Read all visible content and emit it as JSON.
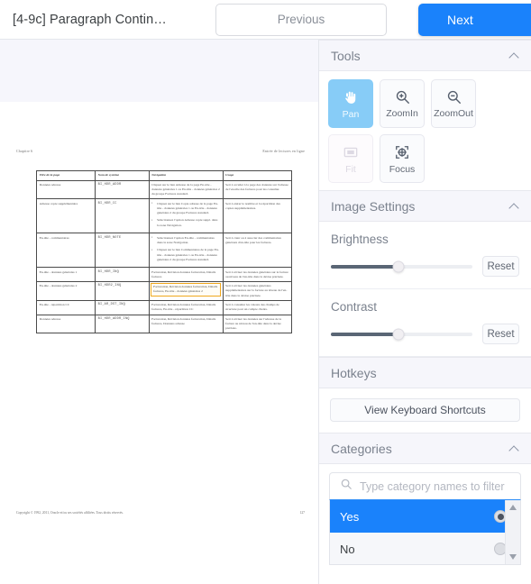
{
  "header": {
    "doc_title": "[4-9c] Paragraph Contin…",
    "previous_label": "Previous",
    "next_label": "Next"
  },
  "tools": {
    "section_title": "Tools",
    "collapse_icon": "chevron-up-icon",
    "items": [
      {
        "label": "Pan",
        "icon": "hand-icon",
        "state": "active"
      },
      {
        "label": "ZoomIn",
        "icon": "magnifier-plus-icon",
        "state": "enabled"
      },
      {
        "label": "ZoomOut",
        "icon": "magnifier-minus-icon",
        "state": "enabled"
      },
      {
        "label": "Fit",
        "icon": "fit-screen-icon",
        "state": "disabled"
      },
      {
        "label": "Focus",
        "icon": "crosshair-target-icon",
        "state": "enabled"
      }
    ]
  },
  "image_settings": {
    "section_title": "Image Settings",
    "collapse_icon": "chevron-up-icon",
    "brightness": {
      "label": "Brightness",
      "value_percent": 48,
      "reset_label": "Reset"
    },
    "contrast": {
      "label": "Contrast",
      "value_percent": 48,
      "reset_label": "Reset"
    }
  },
  "hotkeys": {
    "section_title": "Hotkeys",
    "button_label": "View Keyboard Shortcuts"
  },
  "categories": {
    "section_title": "Categories",
    "collapse_icon": "chevron-up-icon",
    "search_placeholder": "Type category names to filter",
    "search_value": "",
    "search_icon": "search-icon",
    "options": [
      {
        "label": "Yes",
        "selected": true
      },
      {
        "label": "No",
        "selected": false
      }
    ],
    "scroll_up_icon": "triangle-up-icon",
    "scroll_down_icon": "triangle-down-icon"
  },
  "colors": {
    "accent_blue": "#1a82fb",
    "active_tool": "#87ccf7",
    "highlight_box": "#f0a81e",
    "panel_header_bg": "#f6f6fb"
  },
  "document": {
    "running_head_left": "Chapitre 6",
    "running_head_right": "Entrée de lectures en ligne",
    "footer_left": "Copyright © 1992, 2011, Oracle et/ou ses sociétés affiliées. Tous droits réservés.",
    "footer_right": "127",
    "table": {
      "columns": [
        "Titre de la page",
        "Nom de système",
        "Navigation",
        "Usage"
      ],
      "rows": [
        {
          "page_title": "Données adresse",
          "system_name": "BI_HDR_ADDR",
          "navigation_text": "Cliquez sur le lien Adresse de la page En-tête - données générales 1 ou En-tête - données générales 2 du groupe Factures standard.",
          "navigation_bullets": [],
          "usage": "Sert à accéder à la page des données sur l'adresse de l'en-tête des factures pour les consulter.",
          "highlighted": false
        },
        {
          "page_title": "Adresse copie supplémentaire",
          "system_name": "BI_HDR_CC",
          "navigation_text": "",
          "navigation_bullets": [
            "Cliquez sur le lien Copie adresse de la page En-tête - données générales 1 ou En-tête - données générales 2 du groupe Factures standard.",
            "Sélectionnez l'option Adresse copie suppl. dans la zone Navigation."
          ],
          "usage": "Sert à entrer le nombre et la répartition des copies supplémentaires.",
          "highlighted": false
        },
        {
          "page_title": "En-tête - commentaires",
          "system_name": "BI_HDR_NOTE",
          "navigation_text": "",
          "navigation_bullets": [
            "Sélectionnez l'option En-tête - commentaires dans la zone Navigation.",
            "Cliquez sur le lien Commentaires de la page En-tête - données générales 1 ou En-tête - données générales 2 du groupe Factures standard."
          ],
          "usage": "Sert à créer ou à associer des commentaires généraux d'en-tête pour les factures.",
          "highlighted": false
        },
        {
          "page_title": "En-tête - données générales 1",
          "system_name": "BI_HDR_INQ",
          "navigation_text": "Facturation, Révision données facturation, Détails factures",
          "navigation_bullets": [],
          "usage": "Sert à réviser les données générales sur la facture au niveau de l'en-tête dans la devise précisée.",
          "highlighted": false
        },
        {
          "page_title": "En-tête - données générales 2",
          "system_name": "BI_HDR2_INQ",
          "navigation_text": "Facturation, Révision données facturation, Détails factures, En-tête - données générales 2",
          "navigation_bullets": [],
          "usage": "Sert à réviser les données générales supplémentaires sur la facture au niveau de l'en-tête dans la devise précisée.",
          "highlighted": true
        },
        {
          "page_title": "En-tête - répartition CC",
          "system_name": "BI_AR_DST_INQ",
          "navigation_text": "Facturation, Révision données facturation, Détails factures, En-tête - répartition CC",
          "navigation_bullets": [],
          "usage": "Sert à consulter les valeurs des champs de structure pour un compte clients.",
          "highlighted": false
        },
        {
          "page_title": "Données adresse",
          "system_name": "BI_HDR_ADDR_INQ",
          "navigation_text": "Facturation, Révision données facturation, Détails factures, Données adresse",
          "navigation_bullets": [],
          "usage": "Sert à réviser les données sur l'adresse de la facture au niveau de l'en-tête dans la devise précisée.",
          "highlighted": false
        }
      ]
    }
  }
}
